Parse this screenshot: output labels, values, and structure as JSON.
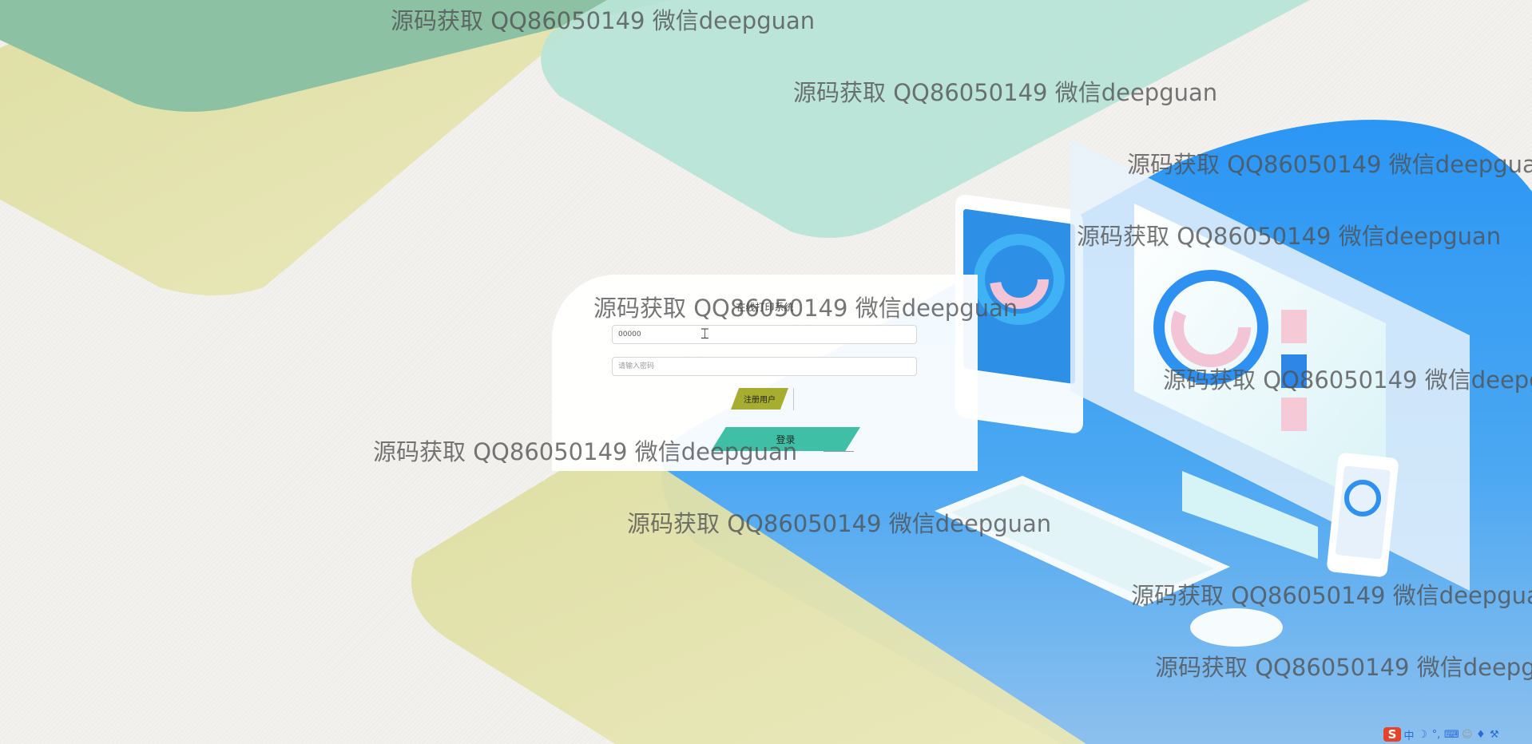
{
  "page": {
    "title": "在线打印系统"
  },
  "login": {
    "title": "在线打印系统",
    "username_value": "00000",
    "password_placeholder": "请输入密码",
    "register_label": "注册用户",
    "login_label": "登录"
  },
  "watermark": {
    "text": "源码获取 QQ86050149 微信deepguan"
  },
  "tray": {
    "ime_logo": "S",
    "ime_lang": "中",
    "icons": [
      "moon-icon",
      "punctuation-icon",
      "keyboard-icon",
      "person-icon",
      "shirt-icon",
      "wrench-icon"
    ]
  },
  "colors": {
    "background": "#f3f1ee",
    "green_band": "#8fc2a6",
    "olive_band": "#dcdb9e",
    "mint_band": "#b9e5d8",
    "blue_shape": "#2e9bf5",
    "register_button": "#a7ad2f",
    "login_button": "#3fbfa6"
  }
}
